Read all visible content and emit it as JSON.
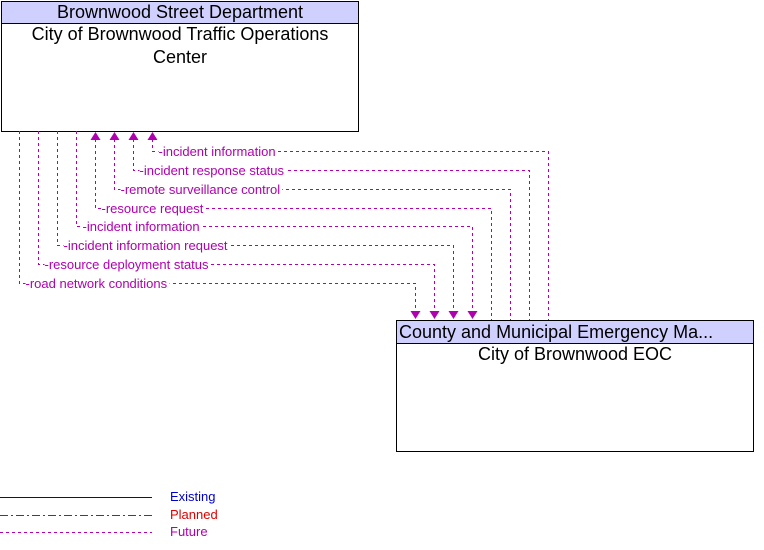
{
  "diagram": {
    "colors": {
      "header_fill": "#d0d0ff",
      "future": "#b000b0",
      "planned": "#e00000",
      "existing": "#0000d0"
    },
    "source_element": {
      "owner": "Brownwood Street Department",
      "name": "City of Brownwood Traffic Operations Center"
    },
    "target_element": {
      "owner": "County and Municipal Emergency Ma...",
      "name": "City of Brownwood EOC"
    },
    "flows": [
      {
        "label": "incident information",
        "direction": "to-source",
        "status": "Future"
      },
      {
        "label": "incident response status",
        "direction": "to-source",
        "status": "Future"
      },
      {
        "label": "remote surveillance control",
        "direction": "to-source",
        "status": "Future"
      },
      {
        "label": "resource request",
        "direction": "to-source",
        "status": "Future"
      },
      {
        "label": "incident information",
        "direction": "to-target",
        "status": "Future"
      },
      {
        "label": "incident information request",
        "direction": "to-target",
        "status": "Future"
      },
      {
        "label": "resource deployment status",
        "direction": "to-target",
        "status": "Future"
      },
      {
        "label": "road network conditions",
        "direction": "to-target",
        "status": "Future"
      }
    ],
    "legend": [
      {
        "label": "Existing",
        "style": "solid",
        "color": "#0000d0"
      },
      {
        "label": "Planned",
        "style": "dash-dot",
        "color": "#e00000"
      },
      {
        "label": "Future",
        "style": "dotted",
        "color": "#b000b0"
      }
    ]
  }
}
